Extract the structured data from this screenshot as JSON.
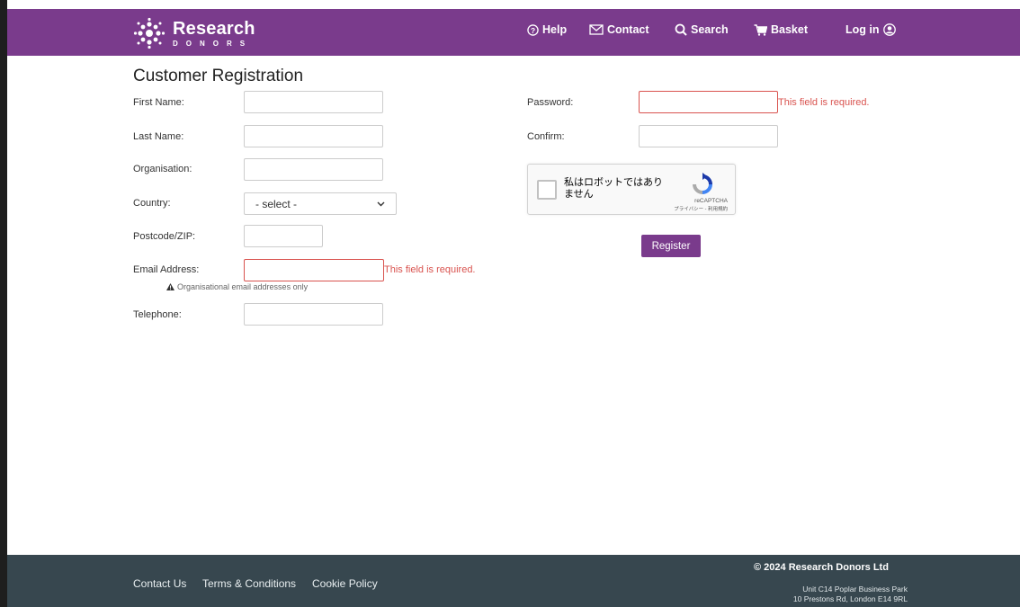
{
  "brand": {
    "title": "Research",
    "subtitle": "DONORS"
  },
  "nav": {
    "help": "Help",
    "contact": "Contact",
    "search": "Search",
    "basket": "Basket",
    "login": "Log in"
  },
  "page": {
    "title": "Customer Registration"
  },
  "form": {
    "first_name": {
      "label": "First Name:",
      "value": ""
    },
    "last_name": {
      "label": "Last Name:",
      "value": ""
    },
    "organisation": {
      "label": "Organisation:",
      "value": ""
    },
    "country": {
      "label": "Country:",
      "selected": "- select -"
    },
    "postcode": {
      "label": "Postcode/ZIP:",
      "value": ""
    },
    "email": {
      "label": "Email Address:",
      "value": "",
      "error": "This field is required.",
      "hint": "Organisational email addresses only"
    },
    "telephone": {
      "label": "Telephone:",
      "value": ""
    },
    "password": {
      "label": "Password:",
      "value": "",
      "error": "This field is required."
    },
    "confirm": {
      "label": "Confirm:",
      "value": ""
    }
  },
  "captcha": {
    "text": "私はロボットではありません",
    "brand": "reCAPTCHA",
    "links": "プライバシー - 利用規約"
  },
  "register_button": "Register",
  "footer": {
    "links": [
      "Contact Us",
      "Terms & Conditions",
      "Cookie Policy"
    ],
    "copyright": "© 2024 Research Donors Ltd",
    "address_line1": "Unit C14 Poplar Business Park",
    "address_line2": "10 Prestons Rd, London E14 9RL"
  },
  "colors": {
    "brand": "#7a3b8c",
    "footer": "#37474f",
    "error": "#d9534f"
  }
}
